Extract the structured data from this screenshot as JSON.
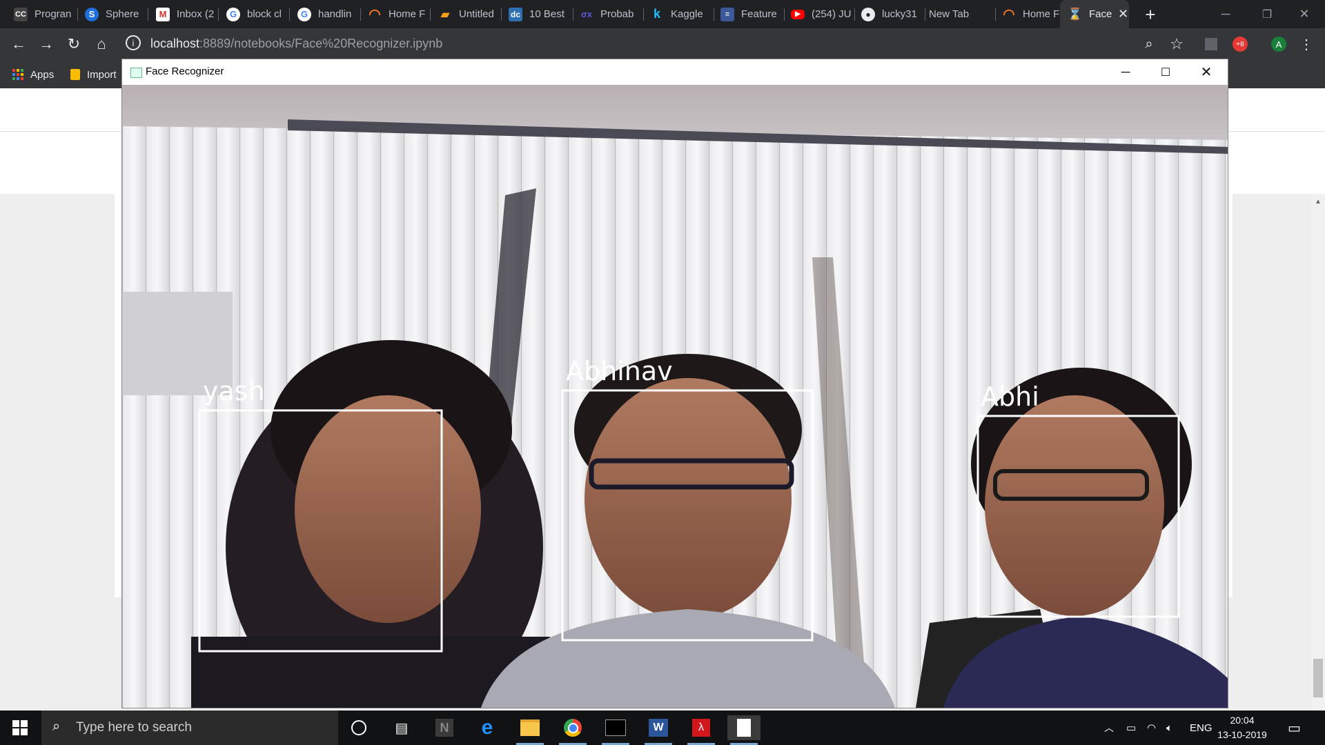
{
  "browser": {
    "tabs": [
      {
        "label": "Progran",
        "icon": "cc-icon"
      },
      {
        "label": "Sphere",
        "icon": "sphere-icon"
      },
      {
        "label": "Inbox (2",
        "icon": "gmail-icon"
      },
      {
        "label": "block cl",
        "icon": "google-icon"
      },
      {
        "label": "handlin",
        "icon": "google-icon"
      },
      {
        "label": "Home F",
        "icon": "jupyter-icon"
      },
      {
        "label": "Untitled",
        "icon": "book-icon"
      },
      {
        "label": "10 Best",
        "icon": "dc-icon"
      },
      {
        "label": "Probab",
        "icon": "stats-icon"
      },
      {
        "label": "Kaggle",
        "icon": "kaggle-icon"
      },
      {
        "label": "Feature",
        "icon": "doc-icon"
      },
      {
        "label": "(254) JU",
        "icon": "youtube-icon"
      },
      {
        "label": "lucky31",
        "icon": "github-icon"
      },
      {
        "label": "New Tab",
        "icon": ""
      },
      {
        "label": "Home F",
        "icon": "jupyter-icon"
      },
      {
        "label": "Face",
        "icon": "hourglass-icon",
        "active": true
      }
    ],
    "url_host": "localhost",
    "url_path": ":8889/notebooks/Face%20Recognizer.ipynb",
    "bookmarks": [
      {
        "label": "Apps"
      },
      {
        "label": "Import"
      }
    ],
    "profile_initial": "A",
    "extension_label": "+8"
  },
  "cv_window": {
    "title": "Face Recognizer",
    "faces": [
      {
        "name": "yash"
      },
      {
        "name": "Abhinav"
      },
      {
        "name": "Abhi"
      }
    ]
  },
  "taskbar": {
    "search_placeholder": "Type here to search",
    "language": "ENG",
    "time": "20:04",
    "date": "13-10-2019"
  },
  "colors": {
    "chrome_dark": "#202124",
    "chrome_toolbar": "#35363a",
    "taskbar": "#101214",
    "box": "#ffffff"
  }
}
